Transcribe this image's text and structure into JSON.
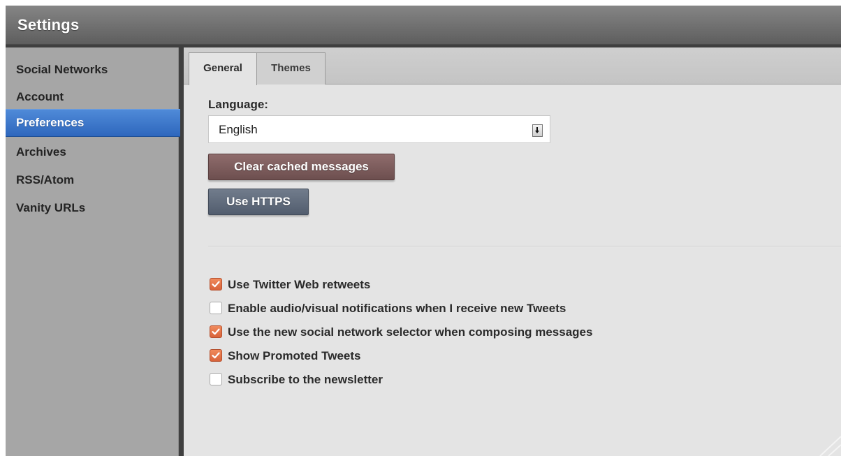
{
  "window": {
    "title": "Settings"
  },
  "sidebar": {
    "items": [
      {
        "label": "Social Networks",
        "active": false
      },
      {
        "label": "Account",
        "active": false
      },
      {
        "label": "Preferences",
        "active": true
      },
      {
        "label": "Archives",
        "active": false
      },
      {
        "label": "RSS/Atom",
        "active": false
      },
      {
        "label": "Vanity URLs",
        "active": false
      }
    ]
  },
  "tabs": [
    {
      "label": "General",
      "active": true
    },
    {
      "label": "Themes",
      "active": false
    }
  ],
  "general": {
    "language_label": "Language:",
    "language_value": "English",
    "clear_cache_label": "Clear cached messages",
    "https_label": "Use HTTPS",
    "options": [
      {
        "label": "Use Twitter Web retweets",
        "checked": true
      },
      {
        "label": "Enable audio/visual notifications when I receive new Tweets",
        "checked": false
      },
      {
        "label": "Use the new social network selector when composing messages",
        "checked": true
      },
      {
        "label": "Show Promoted Tweets",
        "checked": true
      },
      {
        "label": "Subscribe to the newsletter",
        "checked": false
      }
    ]
  },
  "colors": {
    "active_nav": "#3a74c9",
    "checkbox_checked": "#e4764a",
    "clear_button": "#7d5c5c",
    "https_button": "#606b7c"
  },
  "icons": {
    "checkbox_checked": "checkmark-icon",
    "select_arrow": "chevron-down-icon"
  }
}
